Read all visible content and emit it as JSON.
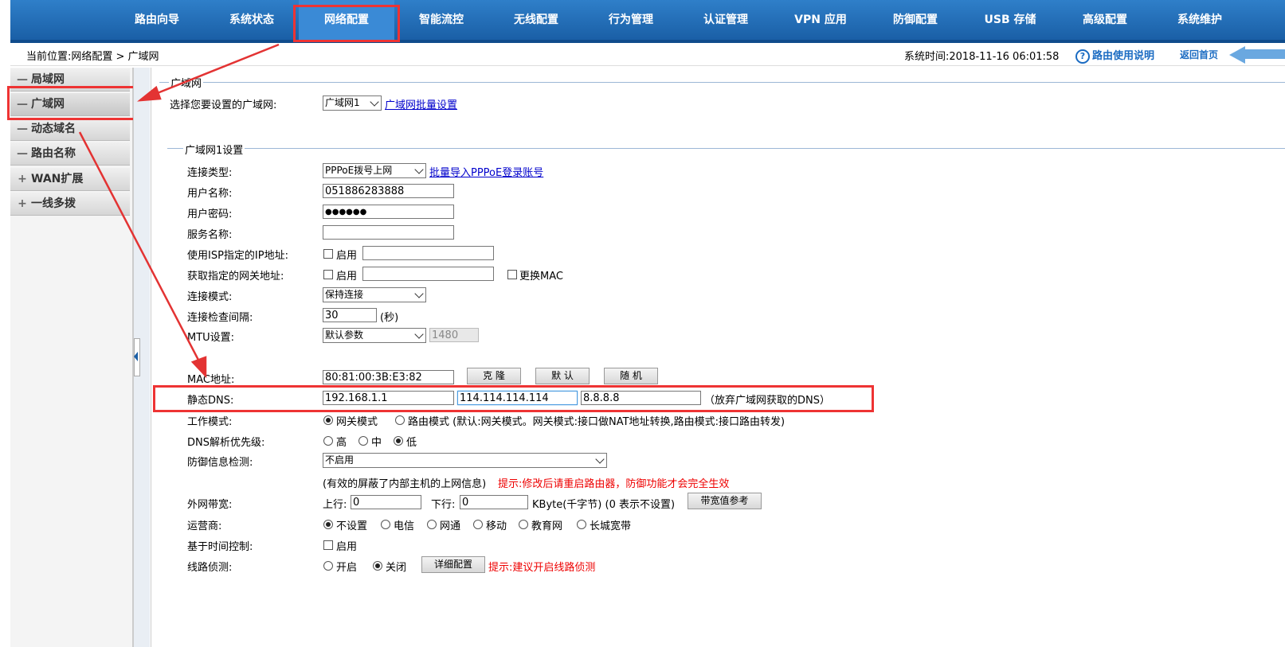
{
  "nav": {
    "items": [
      "路由向导",
      "系统状态",
      "网络配置",
      "智能流控",
      "无线配置",
      "行为管理",
      "认证管理",
      "VPN 应用",
      "防御配置",
      "USB 存储",
      "高级配置",
      "系统维护"
    ]
  },
  "breadcrumb": "当前位置:网络配置 > 广域网",
  "system_time": "系统时间:2018-11-16 06:01:58",
  "help_label": "路由使用说明",
  "home_label": "返回首页",
  "sidebar": {
    "items": [
      {
        "sym": "—",
        "label": "局域网"
      },
      {
        "sym": "—",
        "label": "广域网"
      },
      {
        "sym": "—",
        "label": "动态域名"
      },
      {
        "sym": "—",
        "label": "路由名称"
      },
      {
        "sym": "+",
        "label": "WAN扩展"
      },
      {
        "sym": "+",
        "label": "一线多拨"
      }
    ]
  },
  "section1": {
    "legend": "广域网",
    "select_label": "选择您要设置的广域网:",
    "select_value": "广域网1",
    "batch_link": "广域网批量设置"
  },
  "section2": {
    "legend": "广域网1设置",
    "conn_type_label": "连接类型:",
    "conn_type_value": "PPPoE拨号上网",
    "batch_import_link": "批量导入PPPoE登录账号",
    "username_label": "用户名称:",
    "username_value": "051886283888",
    "password_label": "用户密码:",
    "password_value": "●●●●●●",
    "service_label": "服务名称:",
    "isp_ip_label": "使用ISP指定的IP地址:",
    "enable_label": "启用",
    "gateway_label": "获取指定的网关地址:",
    "change_mac_label": "更换MAC",
    "conn_mode_label": "连接模式:",
    "conn_mode_value": "保持连接",
    "check_interval_label": "连接检查间隔:",
    "check_interval_value": "30",
    "seconds_unit": "(秒)",
    "mtu_label": "MTU设置:",
    "mtu_mode_value": "默认参数",
    "mtu_value": "1480",
    "mac_label": "MAC地址:",
    "mac_value": "80:81:00:3B:E3:82",
    "clone_btn": "克 隆",
    "default_btn": "默 认",
    "random_btn": "随 机",
    "dns_label": "静态DNS:",
    "dns1": "192.168.1.1",
    "dns2": "114.114.114.114",
    "dns3": "8.8.8.8",
    "dns_note": "（放弃广域网获取的DNS）",
    "work_mode_label": "工作模式:",
    "gateway_mode": "网关模式",
    "router_mode": "路由模式 (默认:网关模式。网关模式:接口做NAT地址转换,路由模式:接口路由转发)",
    "dns_priority_label": "DNS解析优先级:",
    "prio_high": "高",
    "prio_mid": "中",
    "prio_low": "低",
    "defense_label": "防御信息检测:",
    "defense_value": "不启用",
    "defense_note": "(有效的屏蔽了内部主机的上网信息)",
    "defense_hint": "提示:修改后请重启路由器，防御功能才会完全生效",
    "bandwidth_label": "外网带宽:",
    "up_label": "上行:",
    "up_value": "0",
    "down_label": "下行:",
    "down_value": "0",
    "bandwidth_unit": "KByte(千字节) (0 表示不设置)",
    "bandwidth_btn": "带宽值参考",
    "isp_label": "运营商:",
    "isp_options": [
      "不设置",
      "电信",
      "网通",
      "移动",
      "教育网",
      "长城宽带"
    ],
    "time_ctrl_label": "基于时间控制:",
    "line_detect_label": "线路侦测:",
    "detect_on": "开启",
    "detect_off": "关闭",
    "detail_btn": "详细配置",
    "detect_hint": "提示:建议开启线路侦测"
  },
  "colors": {
    "nav_bg": "#1a5fa6",
    "annotation": "#e33333",
    "link": "#0000cc",
    "hint": "#ee0000"
  }
}
